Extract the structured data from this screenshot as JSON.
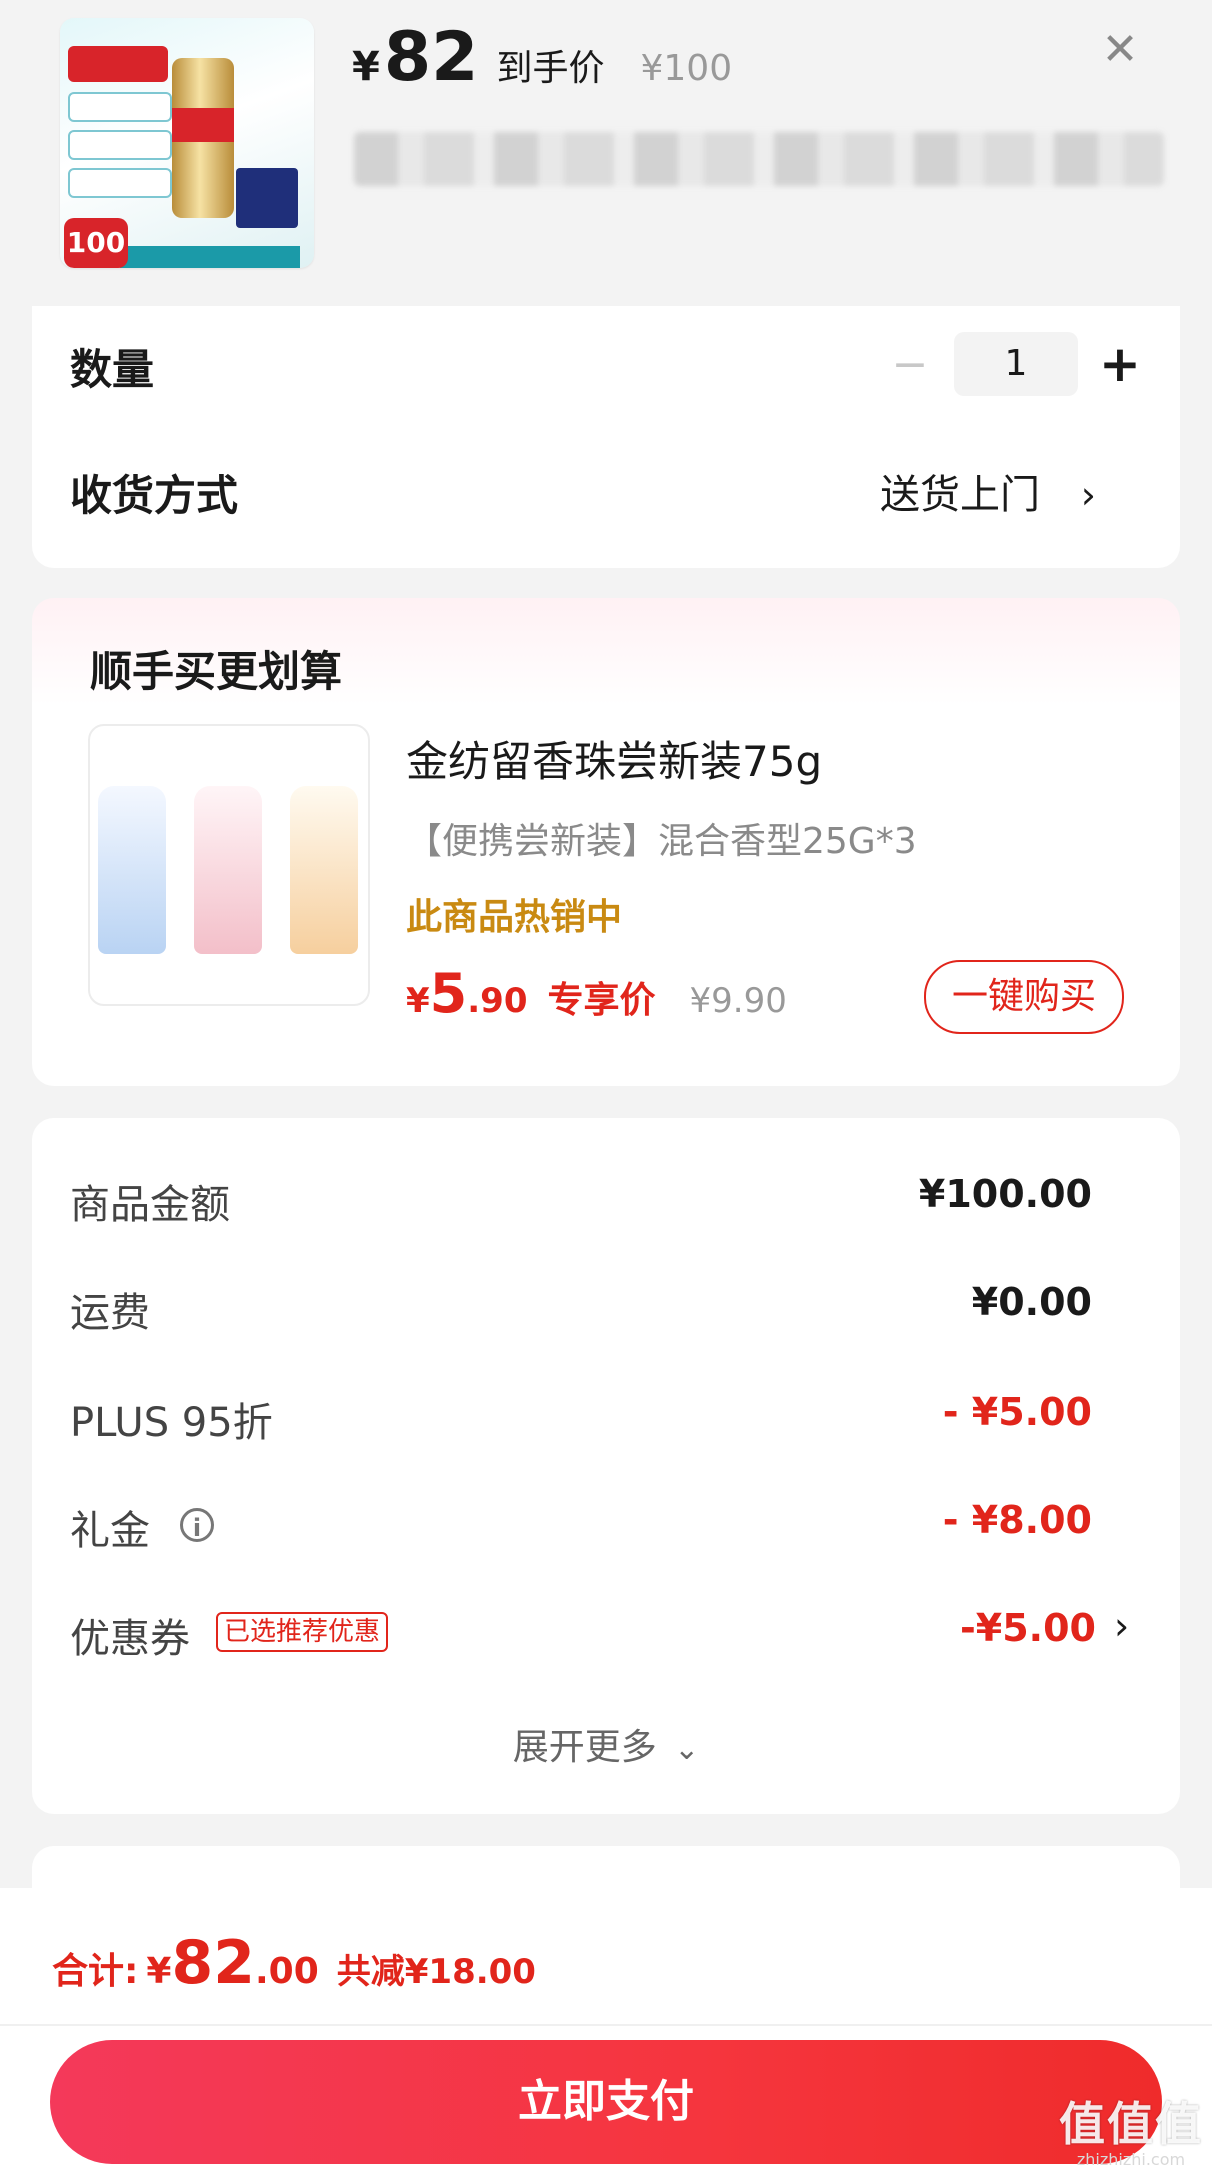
{
  "header": {
    "price_symbol": "¥",
    "price_value": "82",
    "price_label": "到手价",
    "original_price": "¥100",
    "thumb_badge": "100"
  },
  "quantity": {
    "label": "数量",
    "value": "1",
    "minus": "−",
    "plus": "+"
  },
  "delivery": {
    "label": "收货方式",
    "value": "送货上门"
  },
  "upsell": {
    "title": "顺手买更划算",
    "name": "金纺留香珠尝新装75g",
    "desc": "【便携尝新装】混合香型25G*3",
    "hot": "此商品热销中",
    "price_symbol": "¥",
    "price_int": "5",
    "price_dec": ".90",
    "price_tag": "专享价",
    "original_price": "¥9.90",
    "buy_label": "一键购买"
  },
  "summary": {
    "rows": [
      {
        "label": "商品金额",
        "value": "¥100.00"
      },
      {
        "label": "运费",
        "value": "¥0.00"
      },
      {
        "label": "PLUS 95折",
        "value": "- ¥5.00"
      },
      {
        "label": "礼金",
        "value": "- ¥8.00"
      },
      {
        "label": "优惠券",
        "value": "-¥5.00",
        "badge": "已选推荐优惠"
      }
    ],
    "expand_label": "展开更多"
  },
  "footer": {
    "total_label": "合计:",
    "total_symbol": "¥",
    "total_int": "82",
    "total_dec": ".00",
    "saved": "共减¥18.00",
    "pay_label": "立即支付"
  },
  "watermark": {
    "brand": "值值值",
    "site": "zhizhizhi.com"
  },
  "colors": {
    "accent": "#e1251b",
    "hot": "#c98a12",
    "pay_start": "#f4395a",
    "pay_end": "#ef2b2b"
  }
}
